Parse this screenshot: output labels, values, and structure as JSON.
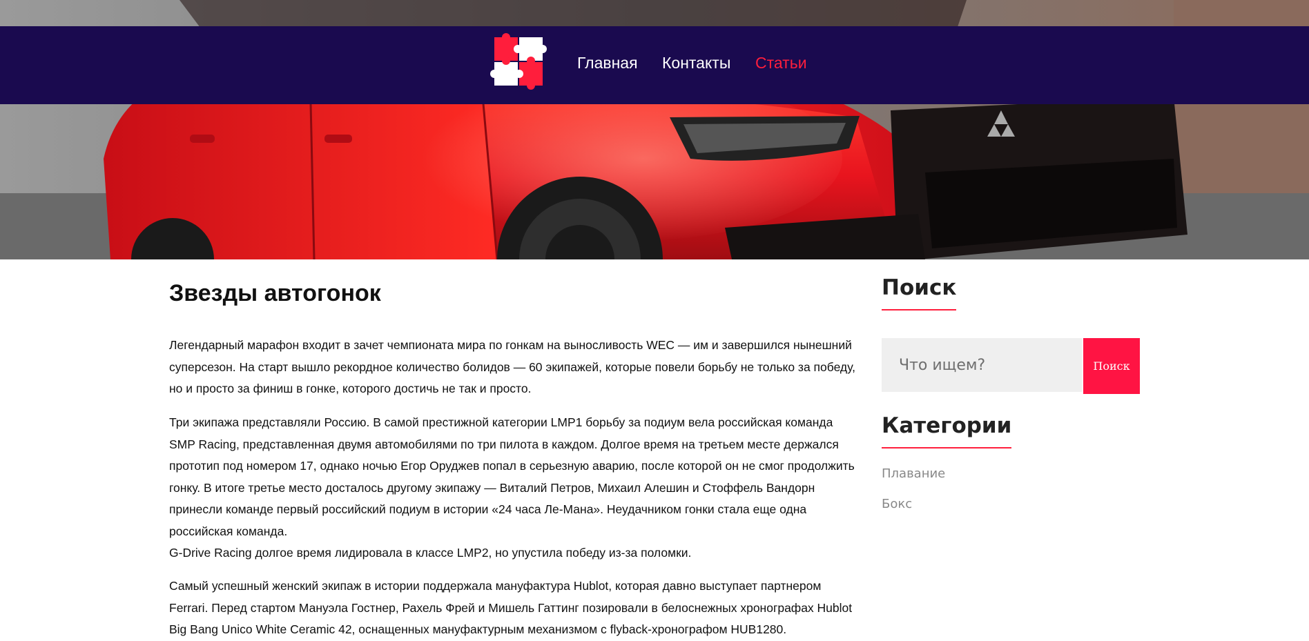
{
  "header": {
    "logo_alt": "puzzle-logo",
    "nav": [
      {
        "label": "Главная",
        "active": false
      },
      {
        "label": "Контакты",
        "active": false
      },
      {
        "label": "Статьи",
        "active": true
      }
    ]
  },
  "article": {
    "title": "Звезды автогонок",
    "paragraphs": [
      "Легендарный марафон входит в зачет чемпионата мира по гонкам на выносливость WEC — им и завершился нынешний суперсезон. На старт вышло рекордное количество болидов — 60 экипажей, которые повели борьбу не только за победу, но и просто за финиш в гонке, которого достичь не так и просто.",
      "Три экипажа представляли Россию. В самой престижной категории LMP1 борьбу за подиум вела российская команда SMP Racing, представленная двумя автомобилями по три пилота в каждом. Долгое время на третьем месте держался прототип под номером 17, однако ночью Егор Оруджев попал в серьезную аварию, после которой он не смог продолжить гонку. В итоге третье место досталось другому экипажу — Виталий Петров, Михаил Алешин и Стоффель Вандорн принесли команде первый российский подиум в истории «24 часа Ле-Мана». Неудачником гонки стала еще одна российская команда.",
      "G-Drive Racing долгое время лидировала в классе LMP2, но упустила победу из-за поломки.",
      "Самый успешный женский экипаж в истории поддержала мануфактура Hublot, которая давно выступает партнером Ferrari. Перед стартом Мануэла Гостнер, Рахель Фрей и Мишель Гаттинг позировали в белоснежных хронографах Hublot Big Bang Unico White Ceramic 42, оснащенных мануфактурным механизмом с flyback-хронографом HUB1280."
    ]
  },
  "sidebar": {
    "search": {
      "title": "Поиск",
      "placeholder": "Что ищем?",
      "button_label": "Поиск"
    },
    "categories": {
      "title": "Категории",
      "items": [
        "Плавание",
        "Бокс"
      ]
    }
  },
  "colors": {
    "nav_bg": "#1a0a4f",
    "accent": "#ff1e3c",
    "car_red": "#e8141e"
  }
}
